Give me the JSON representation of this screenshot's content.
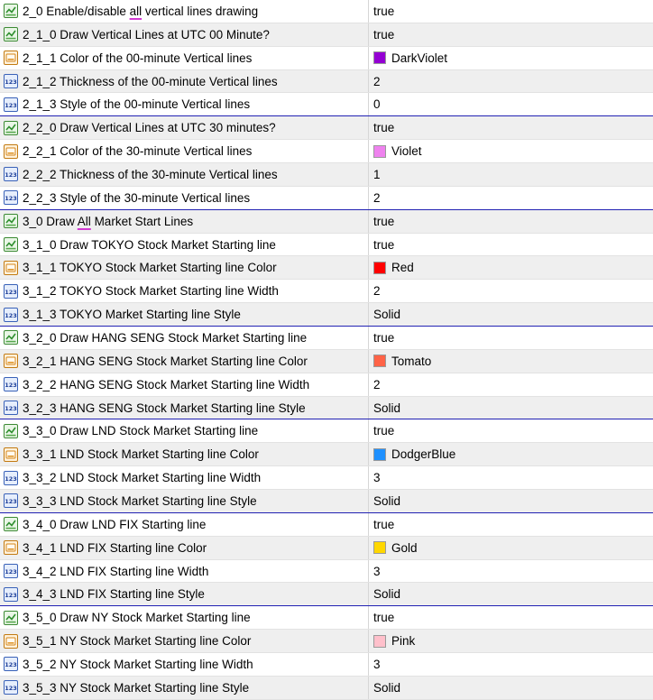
{
  "rows": [
    {
      "icon": "bool",
      "name": "2_0 Enable/disable all vertical lines drawing",
      "value": "true"
    },
    {
      "icon": "bool",
      "name": "2_1_0 Draw Vertical Lines at UTC 00 Minute?",
      "value": "true"
    },
    {
      "icon": "color",
      "name": "2_1_1 Color of the 00-minute Vertical lines",
      "value": "DarkViolet",
      "swatch": "#9400d3"
    },
    {
      "icon": "int",
      "name": "2_1_2 Thickness of the 00-minute Vertical lines",
      "value": "2"
    },
    {
      "icon": "int",
      "name": "2_1_3 Style of the 00-minute Vertical lines",
      "value": "0",
      "group_end": true
    },
    {
      "icon": "bool",
      "name": "2_2_0 Draw Vertical Lines at UTC 30 minutes?",
      "value": "true"
    },
    {
      "icon": "color",
      "name": "2_2_1 Color of the 30-minute Vertical lines",
      "value": "Violet",
      "swatch": "#ee82ee"
    },
    {
      "icon": "int",
      "name": "2_2_2 Thickness of the 30-minute Vertical lines",
      "value": "1"
    },
    {
      "icon": "int",
      "name": "2_2_3 Style of the 30-minute Vertical lines",
      "value": "2",
      "group_end": true
    },
    {
      "icon": "bool",
      "name": "3_0 Draw All Market Start Lines",
      "value": "true"
    },
    {
      "icon": "bool",
      "name": "3_1_0 Draw TOKYO Stock Market Starting line",
      "value": "true"
    },
    {
      "icon": "color",
      "name": "3_1_1 TOKYO Stock Market Starting line Color",
      "value": "Red",
      "swatch": "#ff0000"
    },
    {
      "icon": "int",
      "name": "3_1_2 TOKYO Stock Market Starting line Width",
      "value": "2"
    },
    {
      "icon": "int",
      "name": "3_1_3 TOKYO Market Starting line Style",
      "value": "Solid",
      "group_end": true
    },
    {
      "icon": "bool",
      "name": "3_2_0 Draw HANG SENG Stock Market Starting line",
      "value": "true"
    },
    {
      "icon": "color",
      "name": "3_2_1 HANG SENG Stock Market Starting line Color",
      "value": "Tomato",
      "swatch": "#ff6347"
    },
    {
      "icon": "int",
      "name": "3_2_2 HANG SENG Stock Market Starting line Width",
      "value": "2"
    },
    {
      "icon": "int",
      "name": "3_2_3 HANG SENG Stock Market Starting line Style",
      "value": "Solid",
      "group_end": true
    },
    {
      "icon": "bool",
      "name": "3_3_0 Draw LND Stock Market Starting line",
      "value": "true"
    },
    {
      "icon": "color",
      "name": "3_3_1 LND Stock Market Starting line Color",
      "value": "DodgerBlue",
      "swatch": "#1e90ff"
    },
    {
      "icon": "int",
      "name": "3_3_2 LND Stock Market Starting line Width",
      "value": "3"
    },
    {
      "icon": "int",
      "name": "3_3_3 LND Stock Market Starting line Style",
      "value": "Solid",
      "group_end": true
    },
    {
      "icon": "bool",
      "name": "3_4_0 Draw LND FIX Starting line",
      "value": "true"
    },
    {
      "icon": "color",
      "name": "3_4_1 LND FIX Starting line Color",
      "value": "Gold",
      "swatch": "#ffd700"
    },
    {
      "icon": "int",
      "name": "3_4_2 LND FIX Starting line Width",
      "value": "3"
    },
    {
      "icon": "int",
      "name": "3_4_3 LND FIX Starting line Style",
      "value": "Solid",
      "group_end": true
    },
    {
      "icon": "bool",
      "name": "3_5_0 Draw NY Stock Market Starting line",
      "value": "true"
    },
    {
      "icon": "color",
      "name": "3_5_1 NY Stock Market Starting line Color",
      "value": "Pink",
      "swatch": "#ffc0cb"
    },
    {
      "icon": "int",
      "name": "3_5_2 NY Stock Market Starting line Width",
      "value": "3"
    },
    {
      "icon": "int",
      "name": "3_5_3 NY Stock Market Starting line Style",
      "value": "Solid"
    }
  ],
  "underlined_words": {
    "0": "all",
    "9": "All"
  },
  "icon_names": {
    "bool": "boolean-param-icon",
    "color": "color-param-icon",
    "int": "integer-param-icon"
  }
}
